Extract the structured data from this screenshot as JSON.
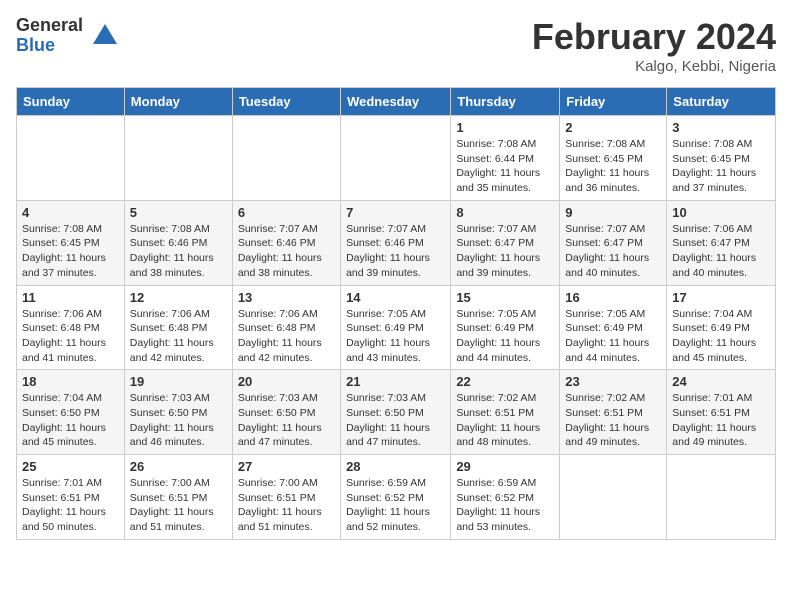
{
  "header": {
    "logo_general": "General",
    "logo_blue": "Blue",
    "title": "February 2024",
    "subtitle": "Kalgo, Kebbi, Nigeria"
  },
  "days_of_week": [
    "Sunday",
    "Monday",
    "Tuesday",
    "Wednesday",
    "Thursday",
    "Friday",
    "Saturday"
  ],
  "weeks": [
    [
      {
        "num": "",
        "sunrise": "",
        "sunset": "",
        "daylight": ""
      },
      {
        "num": "",
        "sunrise": "",
        "sunset": "",
        "daylight": ""
      },
      {
        "num": "",
        "sunrise": "",
        "sunset": "",
        "daylight": ""
      },
      {
        "num": "",
        "sunrise": "",
        "sunset": "",
        "daylight": ""
      },
      {
        "num": "1",
        "sunrise": "Sunrise: 7:08 AM",
        "sunset": "Sunset: 6:44 PM",
        "daylight": "Daylight: 11 hours and 35 minutes."
      },
      {
        "num": "2",
        "sunrise": "Sunrise: 7:08 AM",
        "sunset": "Sunset: 6:45 PM",
        "daylight": "Daylight: 11 hours and 36 minutes."
      },
      {
        "num": "3",
        "sunrise": "Sunrise: 7:08 AM",
        "sunset": "Sunset: 6:45 PM",
        "daylight": "Daylight: 11 hours and 37 minutes."
      }
    ],
    [
      {
        "num": "4",
        "sunrise": "Sunrise: 7:08 AM",
        "sunset": "Sunset: 6:45 PM",
        "daylight": "Daylight: 11 hours and 37 minutes."
      },
      {
        "num": "5",
        "sunrise": "Sunrise: 7:08 AM",
        "sunset": "Sunset: 6:46 PM",
        "daylight": "Daylight: 11 hours and 38 minutes."
      },
      {
        "num": "6",
        "sunrise": "Sunrise: 7:07 AM",
        "sunset": "Sunset: 6:46 PM",
        "daylight": "Daylight: 11 hours and 38 minutes."
      },
      {
        "num": "7",
        "sunrise": "Sunrise: 7:07 AM",
        "sunset": "Sunset: 6:46 PM",
        "daylight": "Daylight: 11 hours and 39 minutes."
      },
      {
        "num": "8",
        "sunrise": "Sunrise: 7:07 AM",
        "sunset": "Sunset: 6:47 PM",
        "daylight": "Daylight: 11 hours and 39 minutes."
      },
      {
        "num": "9",
        "sunrise": "Sunrise: 7:07 AM",
        "sunset": "Sunset: 6:47 PM",
        "daylight": "Daylight: 11 hours and 40 minutes."
      },
      {
        "num": "10",
        "sunrise": "Sunrise: 7:06 AM",
        "sunset": "Sunset: 6:47 PM",
        "daylight": "Daylight: 11 hours and 40 minutes."
      }
    ],
    [
      {
        "num": "11",
        "sunrise": "Sunrise: 7:06 AM",
        "sunset": "Sunset: 6:48 PM",
        "daylight": "Daylight: 11 hours and 41 minutes."
      },
      {
        "num": "12",
        "sunrise": "Sunrise: 7:06 AM",
        "sunset": "Sunset: 6:48 PM",
        "daylight": "Daylight: 11 hours and 42 minutes."
      },
      {
        "num": "13",
        "sunrise": "Sunrise: 7:06 AM",
        "sunset": "Sunset: 6:48 PM",
        "daylight": "Daylight: 11 hours and 42 minutes."
      },
      {
        "num": "14",
        "sunrise": "Sunrise: 7:05 AM",
        "sunset": "Sunset: 6:49 PM",
        "daylight": "Daylight: 11 hours and 43 minutes."
      },
      {
        "num": "15",
        "sunrise": "Sunrise: 7:05 AM",
        "sunset": "Sunset: 6:49 PM",
        "daylight": "Daylight: 11 hours and 44 minutes."
      },
      {
        "num": "16",
        "sunrise": "Sunrise: 7:05 AM",
        "sunset": "Sunset: 6:49 PM",
        "daylight": "Daylight: 11 hours and 44 minutes."
      },
      {
        "num": "17",
        "sunrise": "Sunrise: 7:04 AM",
        "sunset": "Sunset: 6:49 PM",
        "daylight": "Daylight: 11 hours and 45 minutes."
      }
    ],
    [
      {
        "num": "18",
        "sunrise": "Sunrise: 7:04 AM",
        "sunset": "Sunset: 6:50 PM",
        "daylight": "Daylight: 11 hours and 45 minutes."
      },
      {
        "num": "19",
        "sunrise": "Sunrise: 7:03 AM",
        "sunset": "Sunset: 6:50 PM",
        "daylight": "Daylight: 11 hours and 46 minutes."
      },
      {
        "num": "20",
        "sunrise": "Sunrise: 7:03 AM",
        "sunset": "Sunset: 6:50 PM",
        "daylight": "Daylight: 11 hours and 47 minutes."
      },
      {
        "num": "21",
        "sunrise": "Sunrise: 7:03 AM",
        "sunset": "Sunset: 6:50 PM",
        "daylight": "Daylight: 11 hours and 47 minutes."
      },
      {
        "num": "22",
        "sunrise": "Sunrise: 7:02 AM",
        "sunset": "Sunset: 6:51 PM",
        "daylight": "Daylight: 11 hours and 48 minutes."
      },
      {
        "num": "23",
        "sunrise": "Sunrise: 7:02 AM",
        "sunset": "Sunset: 6:51 PM",
        "daylight": "Daylight: 11 hours and 49 minutes."
      },
      {
        "num": "24",
        "sunrise": "Sunrise: 7:01 AM",
        "sunset": "Sunset: 6:51 PM",
        "daylight": "Daylight: 11 hours and 49 minutes."
      }
    ],
    [
      {
        "num": "25",
        "sunrise": "Sunrise: 7:01 AM",
        "sunset": "Sunset: 6:51 PM",
        "daylight": "Daylight: 11 hours and 50 minutes."
      },
      {
        "num": "26",
        "sunrise": "Sunrise: 7:00 AM",
        "sunset": "Sunset: 6:51 PM",
        "daylight": "Daylight: 11 hours and 51 minutes."
      },
      {
        "num": "27",
        "sunrise": "Sunrise: 7:00 AM",
        "sunset": "Sunset: 6:51 PM",
        "daylight": "Daylight: 11 hours and 51 minutes."
      },
      {
        "num": "28",
        "sunrise": "Sunrise: 6:59 AM",
        "sunset": "Sunset: 6:52 PM",
        "daylight": "Daylight: 11 hours and 52 minutes."
      },
      {
        "num": "29",
        "sunrise": "Sunrise: 6:59 AM",
        "sunset": "Sunset: 6:52 PM",
        "daylight": "Daylight: 11 hours and 53 minutes."
      },
      {
        "num": "",
        "sunrise": "",
        "sunset": "",
        "daylight": ""
      },
      {
        "num": "",
        "sunrise": "",
        "sunset": "",
        "daylight": ""
      }
    ]
  ]
}
